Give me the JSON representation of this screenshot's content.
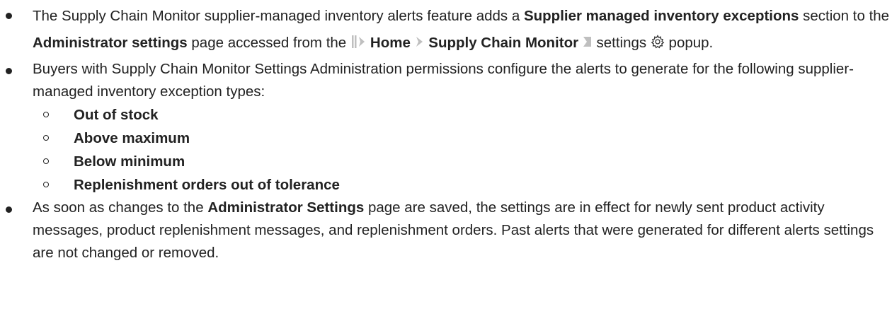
{
  "bullets": {
    "b1": {
      "t1": "The Supply Chain Monitor supplier-managed inventory alerts feature adds a ",
      "t2": "Supplier managed inventory exceptions",
      "t3": " section to the ",
      "t4": "Administrator settings",
      "t5": " page accessed from the ",
      "t6": "Home",
      "t7": "Supply Chain Monitor",
      "t8": " settings ",
      "t9": " popup."
    },
    "b2": {
      "text": "Buyers with Supply Chain Monitor Settings Administration permissions configure the alerts to generate for the following supplier-managed inventory exception types:",
      "subitems": [
        "Out of stock",
        "Above maximum",
        "Below minimum",
        "Replenishment orders out of tolerance"
      ]
    },
    "b3": {
      "t1": "As soon as changes to the ",
      "t2": "Administrator Settings",
      "t3": " page are saved, the settings are in effect for newly sent product activity messages, product replenishment messages, and replenishment orders. Past alerts that were generated for different alerts settings are not changed or removed."
    }
  },
  "icons": [
    "menu-bar-icon",
    "breadcrumb-chevron-icon",
    "gear-icon"
  ],
  "colors": {
    "text": "#222222",
    "icon_gray": "#bfbfbf"
  }
}
